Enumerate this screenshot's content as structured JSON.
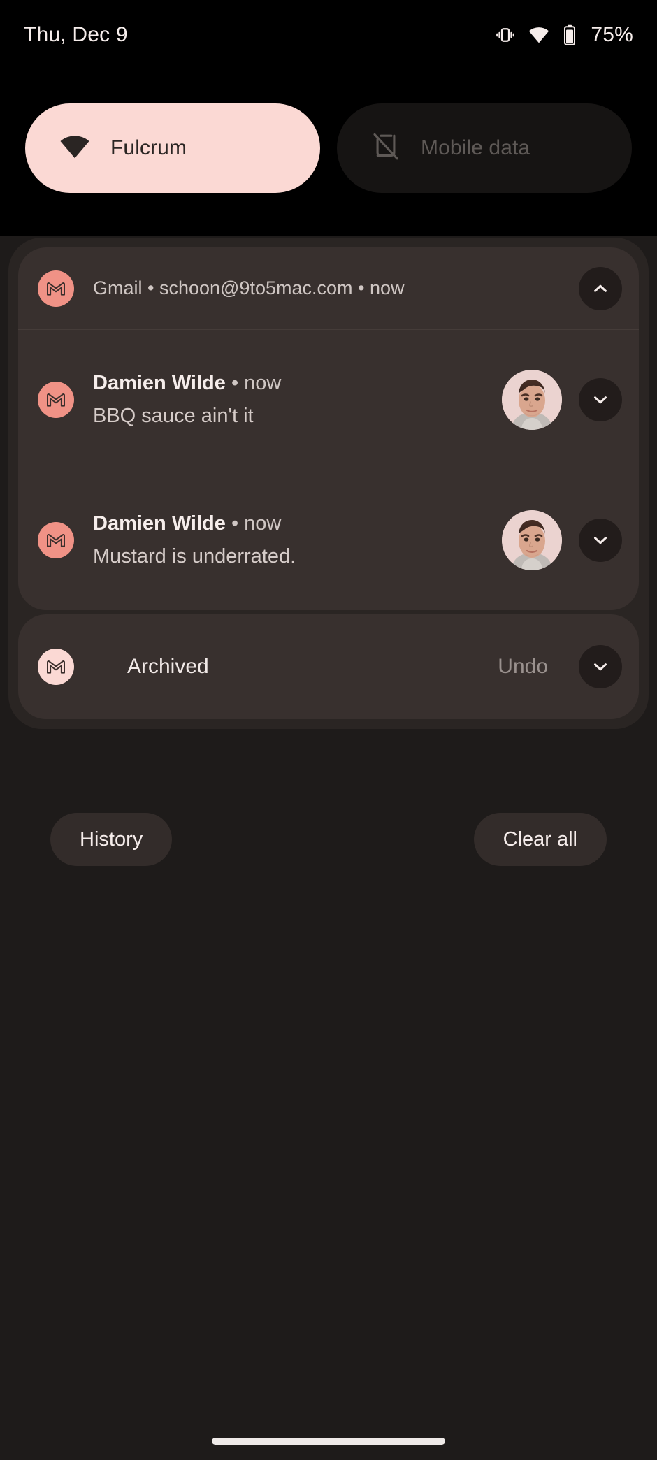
{
  "status_bar": {
    "clock": "Thu, Dec 9",
    "battery_percent": "75%",
    "icons": [
      "vibrate-icon",
      "wifi-icon",
      "battery-icon"
    ]
  },
  "quick_settings": {
    "tiles": [
      {
        "label": "Fulcrum",
        "icon": "wifi-icon",
        "state": "active",
        "bg_color": "#FBD9D4",
        "fg_color": "#2A2523"
      },
      {
        "label": "Mobile data",
        "icon": "mobile-data-off-icon",
        "state": "inactive",
        "bg_color": "#161413",
        "fg_color": "#5E5956"
      }
    ]
  },
  "notification_shade": {
    "group": {
      "header": {
        "app": "Gmail",
        "account": "schoon@9to5mac.com",
        "time": "now",
        "summary": "Gmail • schoon@9to5mac.com • now",
        "icon": "gmail-icon",
        "collapse_icon": "chevron-up-icon"
      },
      "messages": [
        {
          "sender": "Damien Wilde",
          "separator": "•",
          "time": "now",
          "text": "BBQ sauce ain't it",
          "icon": "gmail-icon",
          "avatar": "contact-avatar",
          "expand_icon": "chevron-down-icon"
        },
        {
          "sender": "Damien Wilde",
          "separator": "•",
          "time": "now",
          "text": "Mustard is underrated.",
          "icon": "gmail-icon",
          "avatar": "contact-avatar",
          "expand_icon": "chevron-down-icon"
        }
      ]
    },
    "archived": {
      "label": "Archived",
      "undo_label": "Undo",
      "icon": "gmail-icon",
      "expand_icon": "chevron-down-icon"
    }
  },
  "footer": {
    "history_label": "History",
    "clear_all_label": "Clear all"
  },
  "colors": {
    "screen_bg": "#000000",
    "shade_bg": "#1E1B1A",
    "panel_bg": "#2A2523",
    "card_bg": "#38302E",
    "accent_pink": "#FBD9D4",
    "gmail_salmon": "#F09286",
    "text_primary": "#F6EDEB",
    "text_secondary": "#CFC6C3",
    "text_muted": "#9A918E"
  }
}
